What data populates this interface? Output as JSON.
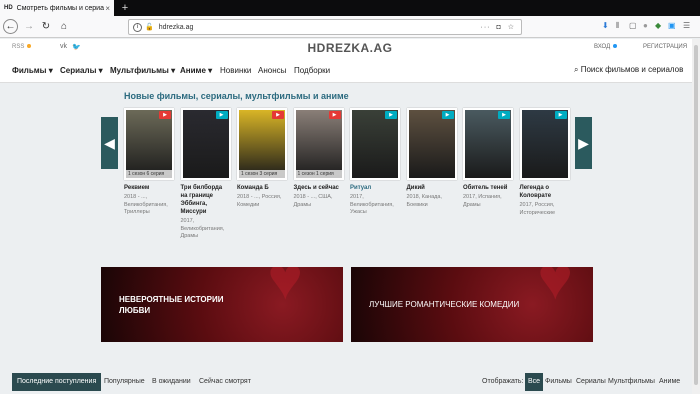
{
  "browser": {
    "tab_title": "Смотреть фильмы и сериа",
    "tab_favicon": "HD",
    "tab_close": "×",
    "new_tab": "+",
    "url": "hdrezka.ag",
    "url_more": "···"
  },
  "site": {
    "rss_label": "RSS",
    "logo": "HDREZKA.AG",
    "login_label": "ВХОД",
    "register_label": "РЕГИСТРАЦИЯ",
    "menu": [
      {
        "label": "Фильмы ▾"
      },
      {
        "label": "Сериалы ▾"
      },
      {
        "label": "Мультфильмы ▾"
      },
      {
        "label": "Аниме ▾"
      },
      {
        "label": "Новинки"
      },
      {
        "label": "Анонсы"
      },
      {
        "label": "Подборки"
      }
    ],
    "search_label": "Поиск фильмов и сериалов"
  },
  "section_title": "Новые фильмы, сериалы, мультфильмы и аниме",
  "cards": [
    {
      "name": "Реквием",
      "meta": "2018 - ..., Великобритания, Триллеры",
      "badge_color": "#e53935",
      "episode": "1 сезон 6 серия",
      "poster_color": "#6c6a58"
    },
    {
      "name": "Три билборда на границе Эббинга, Миссури",
      "meta": "2017, Великобритания, Драмы",
      "badge_color": "#00acc1",
      "episode": "",
      "poster_color": "#2a2a30"
    },
    {
      "name": "Команда Б",
      "meta": "2018 - ..., Россия, Комедии",
      "badge_color": "#e53935",
      "episode": "1 сезон 3 серия",
      "poster_color": "#d9b526"
    },
    {
      "name": "Здесь и сейчас",
      "meta": "2018 - ..., США, Драмы",
      "badge_color": "#e53935",
      "episode": "1 сезон 1 серия",
      "poster_color": "#8a7f78"
    },
    {
      "name": "Ритуал",
      "meta": "2017, Великобритания, Ужасы",
      "badge_color": "#00acc1",
      "episode": "",
      "poster_color": "#3a4038"
    },
    {
      "name": "Дикий",
      "meta": "2018, Канада, Боевики",
      "badge_color": "#00acc1",
      "episode": "",
      "poster_color": "#5e5040"
    },
    {
      "name": "Обитель теней",
      "meta": "2017, Испания, Драмы",
      "badge_color": "#00acc1",
      "episode": "",
      "poster_color": "#4a5a60"
    },
    {
      "name": "Легенда о Коловрате",
      "meta": "2017, Россия, Исторические",
      "badge_color": "#00acc1",
      "episode": "",
      "poster_color": "#2e3a44"
    }
  ],
  "banners": [
    {
      "text": "НЕВЕРОЯТНЫЕ ИСТОРИИ ЛЮБВИ",
      "color": "#5a0c10"
    },
    {
      "text": "ЛУЧШИЕ РОМАНТИЧЕСКИЕ КОМЕДИИ",
      "color": "#5a0c10"
    }
  ],
  "bottom_tabs": [
    "Последние поступления",
    "Популярные",
    "В ожидании",
    "Сейчас смотрят"
  ],
  "filter_tabs": [
    "Отображать:",
    "Все",
    "Фильмы",
    "Сериалы",
    "Мультфильмы",
    "Аниме"
  ]
}
